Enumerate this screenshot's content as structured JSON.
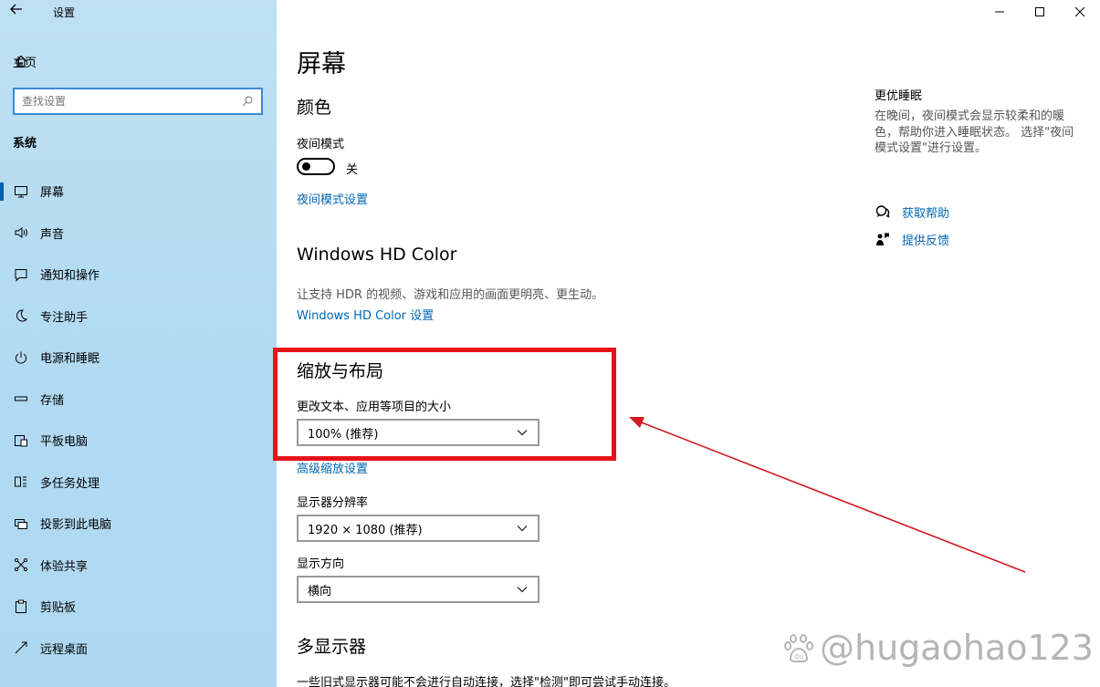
{
  "window": {
    "back_icon": "back-arrow-icon",
    "title": "设置",
    "controls": {
      "minimize": "–",
      "maximize": "☐",
      "close": "✕"
    }
  },
  "sidebar": {
    "home_label": "主页",
    "search_placeholder": "查找设置",
    "section": "系统",
    "items": [
      {
        "label": "屏幕",
        "icon": "monitor-icon",
        "active": true
      },
      {
        "label": "声音",
        "icon": "speaker-icon"
      },
      {
        "label": "通知和操作",
        "icon": "notification-icon"
      },
      {
        "label": "专注助手",
        "icon": "moon-icon"
      },
      {
        "label": "电源和睡眠",
        "icon": "power-icon"
      },
      {
        "label": "存储",
        "icon": "storage-icon"
      },
      {
        "label": "平板电脑",
        "icon": "tablet-icon"
      },
      {
        "label": "多任务处理",
        "icon": "multitask-icon"
      },
      {
        "label": "投影到此电脑",
        "icon": "project-icon"
      },
      {
        "label": "体验共享",
        "icon": "share-icon"
      },
      {
        "label": "剪贴板",
        "icon": "clipboard-icon"
      },
      {
        "label": "远程桌面",
        "icon": "remote-desktop-icon"
      }
    ]
  },
  "main": {
    "title": "屏幕",
    "color": {
      "heading": "颜色",
      "night_label": "夜间模式",
      "night_state": "关",
      "night_link": "夜间模式设置"
    },
    "hdr": {
      "heading": "Windows HD Color",
      "desc": "让支持 HDR 的视频、游戏和应用的画面更明亮、更生动。",
      "link": "Windows HD Color 设置"
    },
    "scale": {
      "heading": "缩放与布局",
      "size_label": "更改文本、应用等项目的大小",
      "size_value": "100% (推荐)",
      "advanced_link": "高级缩放设置",
      "res_label": "显示器分辨率",
      "res_value": "1920 × 1080 (推荐)",
      "orient_label": "显示方向",
      "orient_value": "横向"
    },
    "multi": {
      "heading": "多显示器",
      "desc": "一些旧式显示器可能不会进行自动连接，选择\"检测\"即可尝试手动连接。"
    }
  },
  "right": {
    "title": "更优睡眠",
    "desc": "在晚间，夜间模式会显示较柔和的暖色，帮助你进入睡眠状态。 选择\"夜间模式设置\"进行设置。",
    "help_link": "获取帮助",
    "feedback_link": "提供反馈"
  },
  "watermark": "@hugaohao123",
  "annotation_color": "#e8121a",
  "accent": "#0066b4"
}
